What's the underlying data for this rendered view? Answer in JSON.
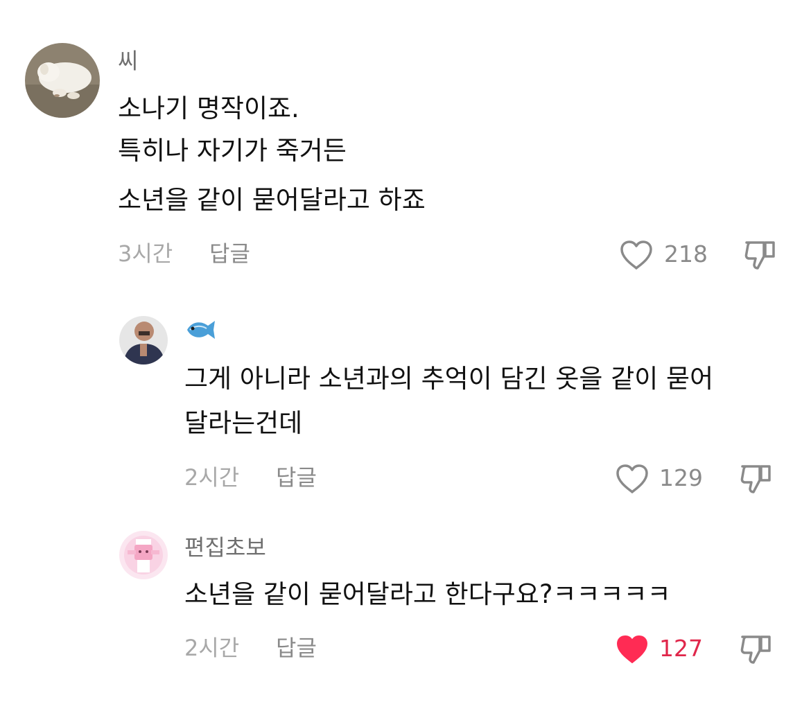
{
  "comments": [
    {
      "username": "씨",
      "lines": [
        "소나기 명작이죠.",
        "특히나 자기가 죽거든",
        "소년을 같이 묻어달라고 하죠"
      ],
      "time": "3시간",
      "reply_label": "답글",
      "likes": "218",
      "liked": false
    },
    {
      "username": "",
      "username_icon": "fish-icon",
      "lines": [
        "그게 아니라 소년과의 추억이 담긴 옷을 같이 묻어",
        "달라는건데"
      ],
      "time": "2시간",
      "reply_label": "답글",
      "likes": "129",
      "liked": false
    },
    {
      "username": "편집초보",
      "lines": [
        "소년을 같이 묻어달라고 한다구요?ㅋㅋㅋㅋㅋ"
      ],
      "time": "2시간",
      "reply_label": "답글",
      "likes": "127",
      "liked": true
    }
  ],
  "colors": {
    "liked_heart": "#ff2b54",
    "liked_count": "#e0264a",
    "muted_text": "#a8a8a8"
  }
}
